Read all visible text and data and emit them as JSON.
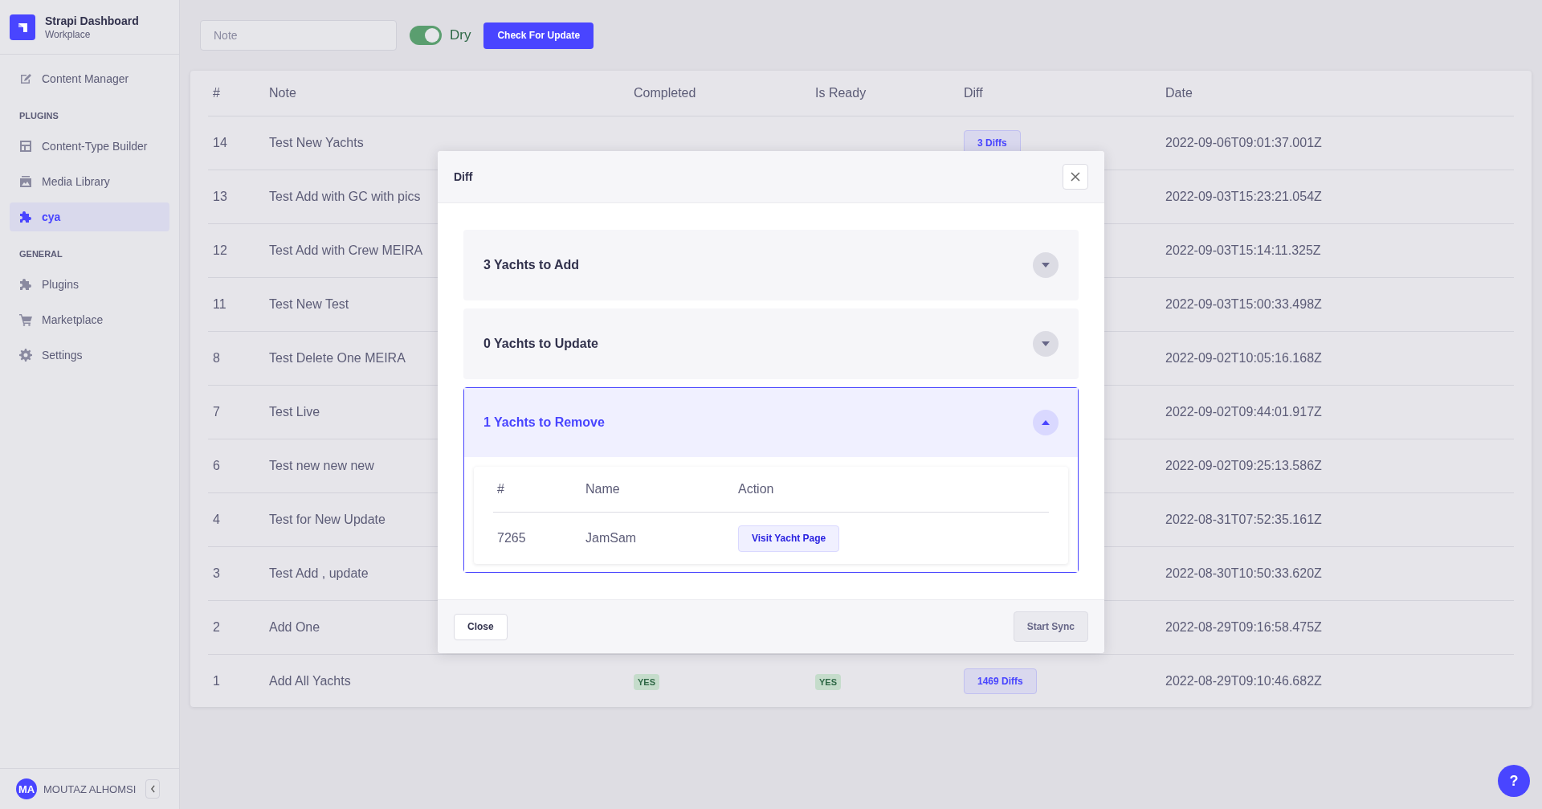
{
  "brand": {
    "title": "Strapi Dashboard",
    "subtitle": "Workplace"
  },
  "sidebar": {
    "sections": [
      {
        "items": [
          {
            "label": "Content Manager",
            "kind": "edit",
            "selected": false
          }
        ]
      },
      {
        "heading": "PLUGINS",
        "items": [
          {
            "label": "Content-Type Builder",
            "kind": "layout",
            "selected": false
          },
          {
            "label": "Media Library",
            "kind": "media",
            "selected": false
          },
          {
            "label": "cya",
            "kind": "puzzle",
            "selected": true
          }
        ]
      },
      {
        "heading": "GENERAL",
        "items": [
          {
            "label": "Plugins",
            "kind": "puzzle",
            "selected": false
          },
          {
            "label": "Marketplace",
            "kind": "cart",
            "selected": false
          },
          {
            "label": "Settings",
            "kind": "gear",
            "selected": false
          }
        ]
      }
    ]
  },
  "user": {
    "initials": "MA",
    "name": "MOUTAZ ALHOMSI"
  },
  "toolbar": {
    "note_placeholder": "Note",
    "toggle": {
      "label": "Dry",
      "on": true
    },
    "button": "Check For Update"
  },
  "table": {
    "columns": [
      "#",
      "Note",
      "Completed",
      "Is Ready",
      "Diff",
      "Date"
    ],
    "rows": [
      {
        "number": "14",
        "note": "Test New Yachts",
        "diff": "3 Diffs",
        "date": "2022-09-06T09:01:37.001Z"
      },
      {
        "number": "13",
        "note": "Test Add with GC with pics",
        "date": "2022-09-03T15:23:21.054Z"
      },
      {
        "number": "12",
        "note": "Test Add with Crew MEIRA",
        "date": "2022-09-03T15:14:11.325Z"
      },
      {
        "number": "11",
        "note": "Test New Test",
        "date": "2022-09-03T15:00:33.498Z"
      },
      {
        "number": "8",
        "note": "Test Delete One MEIRA",
        "date": "2022-09-02T10:05:16.168Z"
      },
      {
        "number": "7",
        "note": "Test Live",
        "date": "2022-09-02T09:44:01.917Z"
      },
      {
        "number": "6",
        "note": "Test new new new",
        "date": "2022-09-02T09:25:13.586Z"
      },
      {
        "number": "4",
        "note": "Test for New Update",
        "date": "2022-08-31T07:52:35.161Z"
      },
      {
        "number": "3",
        "note": "Test Add , update",
        "date": "2022-08-30T10:50:33.620Z"
      },
      {
        "number": "2",
        "note": "Add One",
        "date": "2022-08-29T09:16:58.475Z"
      },
      {
        "number": "1",
        "note": "Add All Yachts",
        "completed": "YES",
        "ready": "YES",
        "diff": "1469 Diffs",
        "date": "2022-08-29T09:10:46.682Z"
      }
    ]
  },
  "modal": {
    "title": "Diff",
    "sections": [
      {
        "title": "3 Yachts to Add",
        "expanded": false
      },
      {
        "title": "0 Yachts to Update",
        "expanded": false
      },
      {
        "title": "1 Yachts to Remove",
        "expanded": true,
        "columns": [
          "#",
          "Name",
          "Action"
        ],
        "rows": [
          {
            "id": "7265",
            "name": "JamSam",
            "action": "Visit Yacht Page"
          }
        ]
      }
    ],
    "close_button": "Close",
    "sync_button": "Start Sync"
  },
  "help_button": "?"
}
